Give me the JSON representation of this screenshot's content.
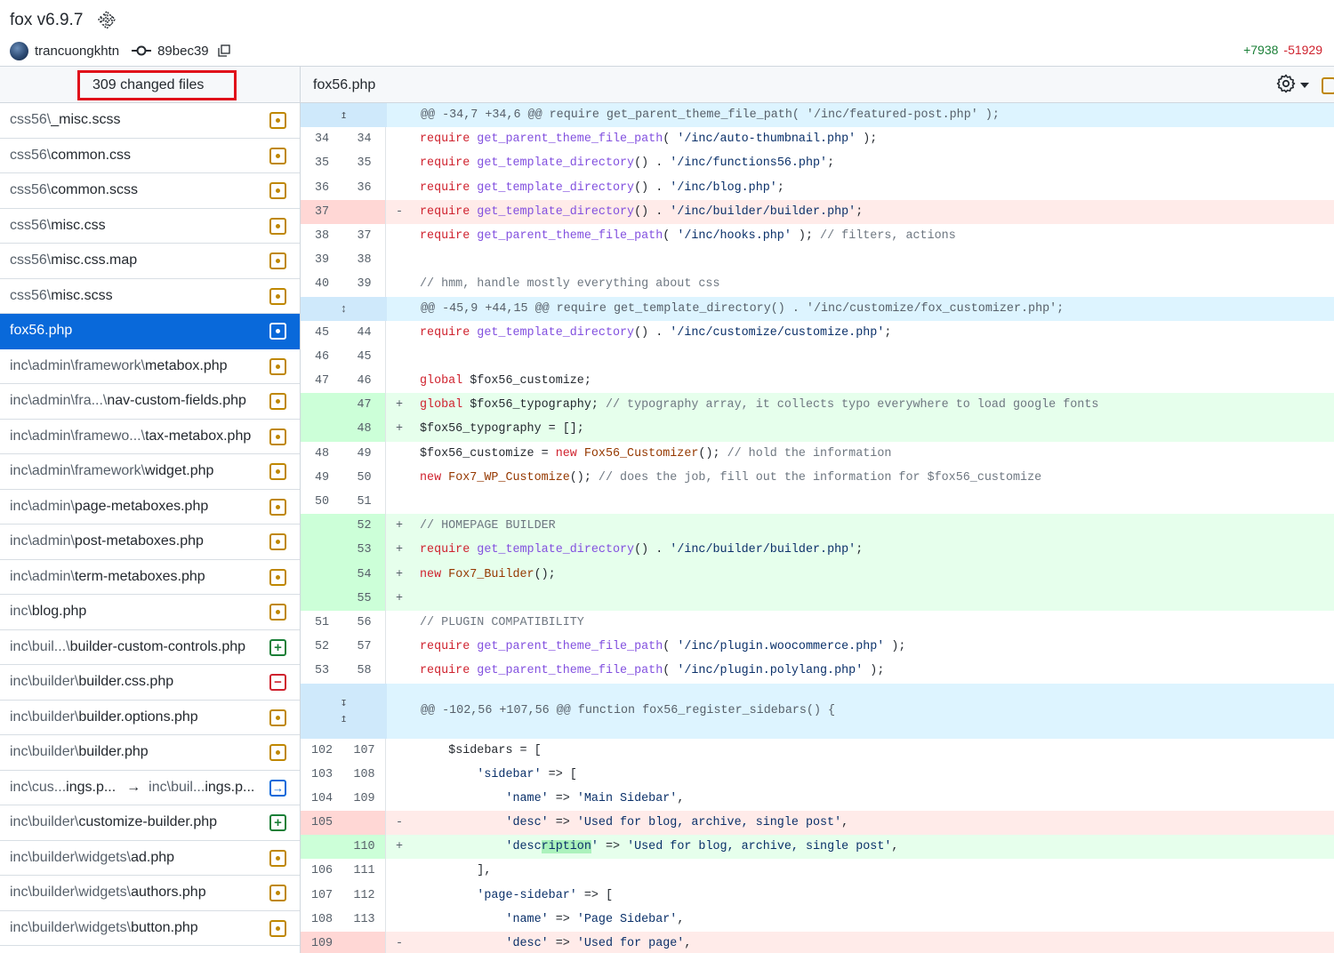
{
  "header": {
    "title": "fox v6.9.7",
    "author": "trancuongkhtn",
    "commit": "89bec39",
    "additions": "+7938",
    "deletions": "-51929"
  },
  "sidebar": {
    "changed_files_label": "309 changed files",
    "files": [
      {
        "dim": "css56\\",
        "name": "_misc.scss",
        "status": "modified"
      },
      {
        "dim": "css56\\",
        "name": "common.css",
        "status": "modified"
      },
      {
        "dim": "css56\\",
        "name": "common.scss",
        "status": "modified"
      },
      {
        "dim": "css56\\",
        "name": "misc.css",
        "status": "modified"
      },
      {
        "dim": "css56\\",
        "name": "misc.css.map",
        "status": "modified"
      },
      {
        "dim": "css56\\",
        "name": "misc.scss",
        "status": "modified"
      },
      {
        "dim": "",
        "name": "fox56.php",
        "status": "modified",
        "active": true
      },
      {
        "dim": "inc\\admin\\framework\\",
        "name": "metabox.php",
        "status": "modified"
      },
      {
        "dim": "inc\\admin\\fra...\\",
        "name": "nav-custom-fields.php",
        "status": "modified"
      },
      {
        "dim": "inc\\admin\\framewo...\\",
        "name": "tax-metabox.php",
        "status": "modified"
      },
      {
        "dim": "inc\\admin\\framework\\",
        "name": "widget.php",
        "status": "modified"
      },
      {
        "dim": "inc\\admin\\",
        "name": "page-metaboxes.php",
        "status": "modified"
      },
      {
        "dim": "inc\\admin\\",
        "name": "post-metaboxes.php",
        "status": "modified"
      },
      {
        "dim": "inc\\admin\\",
        "name": "term-metaboxes.php",
        "status": "modified"
      },
      {
        "dim": "inc\\",
        "name": "blog.php",
        "status": "modified"
      },
      {
        "dim": "inc\\buil...\\",
        "name": "builder-custom-controls.php",
        "status": "added"
      },
      {
        "dim": "inc\\builder\\",
        "name": "builder.css.php",
        "status": "removed"
      },
      {
        "dim": "inc\\builder\\",
        "name": "builder.options.php",
        "status": "modified"
      },
      {
        "dim": "inc\\builder\\",
        "name": "builder.php",
        "status": "modified"
      },
      {
        "dim": "inc\\cus...",
        "name": "ings.p...",
        "dim2": "inc\\buil...",
        "name2": "ings.p...",
        "status": "renamed"
      },
      {
        "dim": "inc\\builder\\",
        "name": "customize-builder.php",
        "status": "added"
      },
      {
        "dim": "inc\\builder\\widgets\\",
        "name": "ad.php",
        "status": "modified"
      },
      {
        "dim": "inc\\builder\\widgets\\",
        "name": "authors.php",
        "status": "modified"
      },
      {
        "dim": "inc\\builder\\widgets\\",
        "name": "button.php",
        "status": "modified"
      }
    ]
  },
  "diff": {
    "filename": "fox56.php",
    "hunks": [
      "@@ -34,7 +34,6 @@ require get_parent_theme_file_path( '/inc/featured-post.php' );",
      "@@ -45,9 +44,15 @@ require get_template_directory() . '/inc/customize/fox_customizer.php';",
      "@@ -102,56 +107,56 @@ function fox56_register_sidebars() {"
    ],
    "line_numbers": {
      "a": [
        "34",
        "35",
        "36",
        "37",
        "38",
        "39",
        "40"
      ],
      "b": [
        "34",
        "35",
        "36",
        "",
        "37",
        "38",
        "39"
      ],
      "a2": [
        "45",
        "46",
        "47",
        "",
        "",
        "48",
        "49",
        "50",
        "",
        "",
        "",
        "",
        "51",
        "52",
        "53"
      ],
      "b2": [
        "44",
        "45",
        "46",
        "47",
        "48",
        "49",
        "50",
        "51",
        "52",
        "53",
        "54",
        "55",
        "56",
        "57",
        "58"
      ],
      "a3": [
        "102",
        "103",
        "104",
        "105",
        "",
        "106",
        "107",
        "108",
        "109"
      ],
      "b3": [
        "107",
        "108",
        "109",
        "",
        "110",
        "111",
        "112",
        "113",
        ""
      ]
    }
  },
  "colors": {
    "accent": "#0969da",
    "highlight_box": "#e0101a",
    "added_bg": "#e6ffec",
    "deleted_bg": "#ffebe9",
    "hunk_bg": "#ddf4ff"
  }
}
